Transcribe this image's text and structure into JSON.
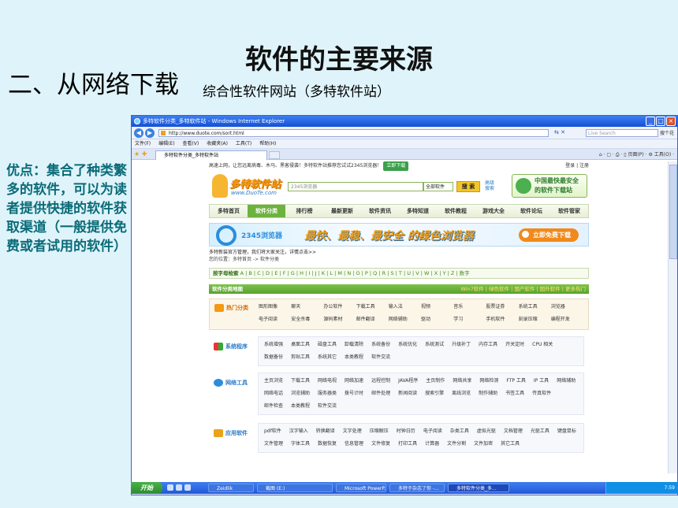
{
  "slide": {
    "title": "软件的主要来源",
    "section_heading": "二、从网络下载",
    "section_sub": "综合性软件网站（多特软件站）",
    "left_note": "优点：集合了种类繁多的软件，可以为读者提供快捷的软件获取渠道（一般提供免费或者试用的软件）"
  },
  "browser": {
    "window_title": "多特软件分类_多特软件站 - Windows Internet Explorer",
    "url": "http://www.duote.com/sort.html",
    "live_search_placeholder": "Live Search",
    "addr_right": "搜个花",
    "menu": [
      "文件(F)",
      "编辑(E)",
      "查看(V)",
      "收藏夹(A)",
      "工具(T)",
      "帮助(H)"
    ],
    "tab_label": "多特软件分类_多特软件站",
    "toolbar_right": "⌂ · ▢ · ⎙ · ▯ 页面(P) · ⚙ 工具(O) ·",
    "status_zone": "Internet",
    "status_zoom": "100%"
  },
  "site": {
    "notice": "高速上网，让您远离病毒、木马、黑客侵袭！多特软件站推荐您试试2345浏览器！",
    "notice_button": "立即下载",
    "login": "登录 | 注册",
    "logo_name": "多特软件站",
    "logo_url": "www.DuoTe.com",
    "search_placeholder": "2345浏览器",
    "category_select": "全部软件",
    "search_button": "搜 索",
    "adv_search": "高级搜索",
    "badge_line1": "中国最快最安全",
    "badge_line2": "的软件下载站",
    "nav": [
      "多特首页",
      "软件分类",
      "排行榜",
      "最新更新",
      "软件资讯",
      "多特知道",
      "软件教程",
      "游戏大全",
      "软件论坛",
      "软件管家"
    ],
    "nav_active": 1,
    "banner_brand": "2345浏览器",
    "banner_slogan": "最快、最稳、最安全 的绿色浏览器",
    "banner_button": "立即免费下载",
    "welcome": "多特新装官方管理，我们将大家关注，详情点击>>",
    "breadcrumb": "您的位置：多特首页 -> 软件分类",
    "alpha_label": "按字母检索",
    "alpha_letters": "A | B | C | D | E | F | G | H | I | J | K | L | M | N | O | P | Q | R | S | T | U | V | W | X | Y | Z | 数字",
    "map_label": "软件分类地图",
    "map_links": "Win7软件 | 绿色软件 | 国产软件 | 国外软件 | 更多热门",
    "hot": {
      "label": "热门分类",
      "items": [
        "图形图像",
        "聊天",
        "办公软件",
        "下载工具",
        "输入法",
        "视频",
        "音乐",
        "股票证券",
        "系统工具",
        "浏览器",
        "电子阅读",
        "安全杀毒",
        "源码素材",
        "邮件翻译",
        "网络辅助",
        "驱动",
        "学习",
        "手机软件",
        "刻录压缩",
        "编程开发"
      ]
    },
    "system": {
      "label": "系统程序",
      "items": [
        "系统增强",
        "桌面工具",
        "磁盘工具",
        "卸载清除",
        "系统备份",
        "系统优化",
        "系统测试",
        "升级补丁",
        "内存工具",
        "开关定时",
        "CPU 相关",
        "数据备份",
        "剪贴工具",
        "系统其它",
        "本类教程",
        "软件交流"
      ]
    },
    "network": {
      "label": "网络工具",
      "items": [
        "主页浏览",
        "下载工具",
        "网络电视",
        "网络加速",
        "远程控制",
        "JAVA程序",
        "主页制作",
        "网络共享",
        "网络检测",
        "FTP 工具",
        "IP 工具",
        "网络辅助",
        "网络电话",
        "浏览辅助",
        "服务器类",
        "拨号计时",
        "邮件处理",
        "新闻阅读",
        "搜索引擎",
        "离线浏览",
        "制作辅助",
        "书签工具",
        "传真软件",
        "邮件检查",
        "本类教程",
        "软件交流"
      ]
    },
    "apps": {
      "label": "应用软件",
      "items": [
        "pdf软件",
        "汉字输入",
        "转换翻译",
        "文字处理",
        "压缩解压",
        "时钟日历",
        "电子阅读",
        "杂类工具",
        "虚拟光驱",
        "文档管理",
        "光驱工具",
        "键盘鼠标",
        "文件管理",
        "字体工具",
        "数据恢复",
        "信息管理",
        "文件修复",
        "打印工具",
        "计算器",
        "文件分割",
        "文件加密",
        "其它工具"
      ]
    }
  },
  "taskbar": {
    "start": "开始",
    "tasks": [
      "Zeidlik",
      "截图 (E:)",
      "Microsoft PowerP...",
      "多特于杂志了你 -...",
      "多特软件分类_多..."
    ],
    "active_task": 4,
    "time": "7:59"
  },
  "colors": {
    "accent_green": "#6cb33e",
    "teal_text": "#0b6b78",
    "xp_blue": "#2158d6"
  }
}
